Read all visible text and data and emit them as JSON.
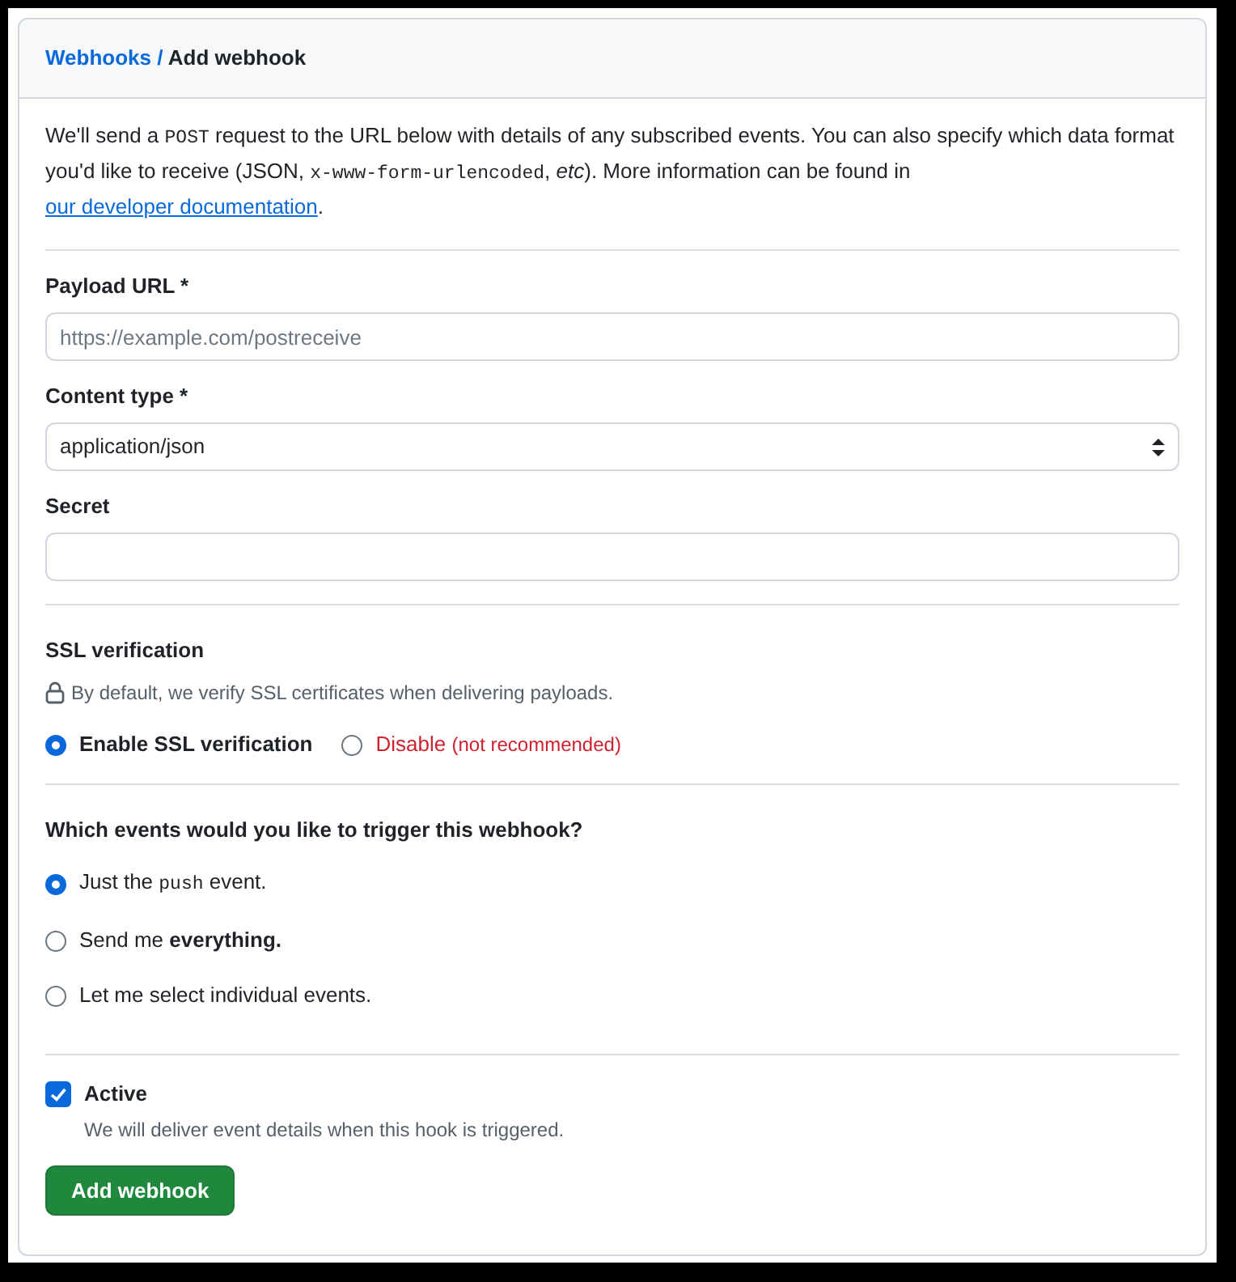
{
  "breadcrumb": {
    "parent": "Webhooks",
    "separator": "/",
    "current": "Add webhook"
  },
  "description": [
    {
      "kind": "text",
      "text": "We'll send a "
    },
    {
      "kind": "code",
      "text": "POST"
    },
    {
      "kind": "text",
      "text": " request to the URL below with details of any subscribed events. You can also specify which data format you'd like to receive (JSON, "
    },
    {
      "kind": "code",
      "text": "x-www-form-urlencoded"
    },
    {
      "kind": "text",
      "text": ", "
    },
    {
      "kind": "italic",
      "text": "etc"
    },
    {
      "kind": "text",
      "text": "). More information can be found in "
    },
    {
      "kind": "link",
      "text": "our developer documentation"
    },
    {
      "kind": "text",
      "text": "."
    }
  ],
  "fields": [
    {
      "kind": "input",
      "label": "Payload URL *",
      "placeholder": "https://example.com/postreceive"
    },
    {
      "kind": "select",
      "label": "Content type *",
      "value": "application/json"
    },
    {
      "kind": "input",
      "label": "Secret"
    }
  ],
  "ssl": {
    "title": "SSL verification",
    "note": "By default, we verify SSL certificates when delivering payloads.",
    "options": [
      {
        "kind": "plain",
        "label": "Enable SSL verification",
        "selected": true
      },
      {
        "kind": "danger",
        "label": "Disable",
        "hint": "(not recommended)",
        "selected": false
      }
    ]
  },
  "events": {
    "question": "Which events would you like to trigger this webhook?",
    "options": [
      {
        "segments": [
          {
            "kind": "text",
            "text": "Just the "
          },
          {
            "kind": "code",
            "text": "push"
          },
          {
            "kind": "text",
            "text": " event."
          }
        ],
        "selected": true
      },
      {
        "segments": [
          {
            "kind": "text",
            "text": "Send me "
          },
          {
            "kind": "bold",
            "text": "everything."
          }
        ],
        "selected": false
      },
      {
        "segments": [
          {
            "kind": "text",
            "text": "Let me select individual events."
          }
        ],
        "selected": false
      }
    ]
  },
  "active": {
    "label": "Active",
    "checked": true,
    "note": "We will deliver event details when this hook is triggered."
  },
  "submit": "Add webhook"
}
